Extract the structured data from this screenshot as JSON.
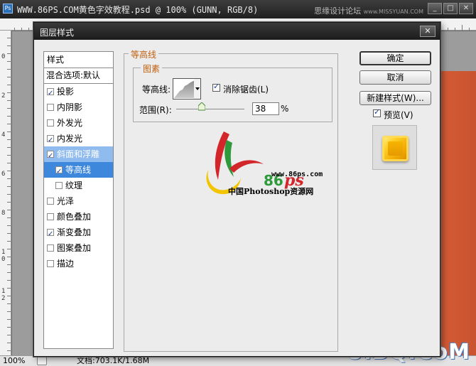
{
  "ps_window": {
    "title": "WWW.86PS.COM黄色字效教程.psd @ 100% (GUNN, RGB/8)",
    "watermark_top": "思缘设计论坛",
    "watermark_top_small": "www.MISSYUAN.COM",
    "minimize_glyph": "_",
    "maximize_glyph": "□",
    "close_glyph": "✕",
    "ruler_numbers": [
      "0",
      "2",
      "4",
      "6",
      "8",
      "1\n0",
      "1\n2"
    ]
  },
  "status_bar": {
    "zoom": "100%",
    "doc_info": "文档:703.1K/1.68M"
  },
  "watermark_bottom": "UiBQ.CoM",
  "dialog": {
    "title": "图层样式",
    "close_glyph": "✕",
    "styles_header": "样式",
    "blend_options": "混合选项:默认",
    "styles": [
      {
        "label": "投影",
        "checked": true
      },
      {
        "label": "内阴影",
        "checked": false
      },
      {
        "label": "外发光",
        "checked": false
      },
      {
        "label": "内发光",
        "checked": true
      },
      {
        "label": "斜面和浮雕",
        "checked": true,
        "selected": true
      },
      {
        "label": "等高线",
        "checked": true,
        "selected": true,
        "sub": true
      },
      {
        "label": "纹理",
        "checked": false,
        "sub": true
      },
      {
        "label": "光泽",
        "checked": false
      },
      {
        "label": "颜色叠加",
        "checked": false
      },
      {
        "label": "渐变叠加",
        "checked": true
      },
      {
        "label": "图案叠加",
        "checked": false
      },
      {
        "label": "描边",
        "checked": false
      }
    ],
    "panel": {
      "group_title": "等高线",
      "subgroup_title": "图素",
      "contour_label": "等高线:",
      "antialias_label": "消除锯齿(L)",
      "antialias_checked": true,
      "range_label": "范围(R):",
      "range_value": "38",
      "range_unit": "%",
      "range_fraction": 0.38
    },
    "logo": {
      "digits": "86",
      "letters": "ps",
      "url": "www.86ps.com",
      "tagline": "中国Photoshop资源网"
    },
    "buttons": {
      "ok": "确定",
      "cancel": "取消",
      "new_style": "新建样式(W)...",
      "preview_label": "预览(V)",
      "preview_checked": true
    }
  },
  "colors": {
    "selection": "#3d87dc",
    "group_title": "#c06010",
    "canvas_orange": "#e0663c",
    "logo_red": "#d2262b",
    "logo_green": "#2f9a3c",
    "logo_yellow": "#f2c500"
  }
}
